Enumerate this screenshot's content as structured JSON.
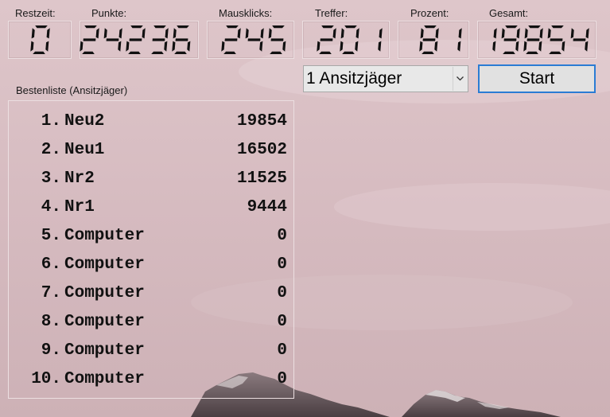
{
  "stats": [
    {
      "label": "Restzeit:",
      "value": "0"
    },
    {
      "label": "Punkte:",
      "value": "24236"
    },
    {
      "label": "Mausklicks:",
      "value": "245"
    },
    {
      "label": "Treffer:",
      "value": "201"
    },
    {
      "label": "Prozent:",
      "value": "81"
    },
    {
      "label": "Gesamt:",
      "value": "19854"
    }
  ],
  "mode_select": {
    "value": "1 Ansitzjäger"
  },
  "start_button": {
    "label": "Start"
  },
  "highscores": {
    "title": "Bestenliste (Ansitzjäger)",
    "entries": [
      {
        "rank": "1.",
        "name": "Neu2",
        "score": "19854"
      },
      {
        "rank": "2.",
        "name": "Neu1",
        "score": "16502"
      },
      {
        "rank": "3.",
        "name": "Nr2",
        "score": "11525"
      },
      {
        "rank": "4.",
        "name": "Nr1",
        "score": "9444"
      },
      {
        "rank": "5.",
        "name": "Computer",
        "score": "0"
      },
      {
        "rank": "6.",
        "name": "Computer",
        "score": "0"
      },
      {
        "rank": "7.",
        "name": "Computer",
        "score": "0"
      },
      {
        "rank": "8.",
        "name": "Computer",
        "score": "0"
      },
      {
        "rank": "9.",
        "name": "Computer",
        "score": "0"
      },
      {
        "rank": "10.",
        "name": "Computer",
        "score": "0"
      }
    ]
  },
  "colors": {
    "button_border": "#2a7cd4",
    "lcd_digit": "#111111"
  }
}
